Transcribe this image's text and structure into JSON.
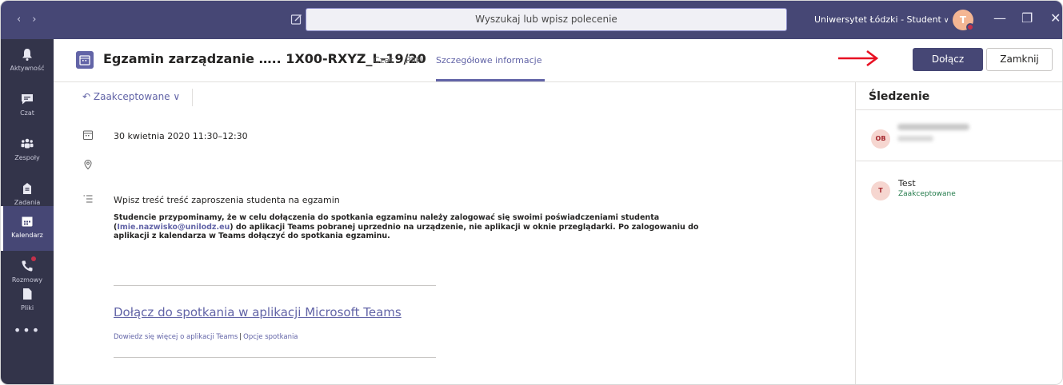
{
  "titlebar": {
    "search_placeholder": "Wyszukaj lub wpisz polecenie",
    "org": "Uniwersytet Łódzki - Student",
    "avatar_initial": "T",
    "minimize": "—",
    "maximize": "❐",
    "close": "✕",
    "nav": "‹›"
  },
  "rail": {
    "items": [
      {
        "label": "Aktywność",
        "icon": "bell-icon"
      },
      {
        "label": "Czat",
        "icon": "chat-icon"
      },
      {
        "label": "Zespoły",
        "icon": "teams-icon"
      },
      {
        "label": "Zadania",
        "icon": "assignments-icon"
      },
      {
        "label": "Kalendarz",
        "icon": "calendar-icon"
      },
      {
        "label": "Rozmowy",
        "icon": "phone-icon"
      },
      {
        "label": "Pliki",
        "icon": "file-icon"
      }
    ],
    "more": "•••",
    "active": "Kalendarz"
  },
  "header": {
    "title": "Egzamin zarządzanie ….. 1X00-RXYZ_L-19/20",
    "tabs": [
      {
        "label": "Czat"
      },
      {
        "label": "Pliki"
      },
      {
        "label": "Szczegółowe informacje"
      }
    ],
    "active_tab": "Szczegółowe informacje",
    "join_label": "Dołącz",
    "close_label": "Zamknij",
    "arrow_color": "#e81123"
  },
  "main": {
    "response": "Zaakceptowane",
    "date": "30 kwietnia 2020 11:30–12:30",
    "description": "Wpisz treść treść zaproszenia studenta na egzamin",
    "notice_before": "Studencie przypominamy, że w celu dołączenia do spotkania egzaminu należy zalogować się swoimi poświadczeniami studenta (",
    "notice_link": "Imie.nazwisko@unilodz.eu",
    "notice_after": ") do aplikacji Teams pobranej uprzednio na urządzenie, nie aplikacji w oknie przeglądarki. Po zalogowaniu do aplikacji z kalendarza w Teams dołączyć do spotkania egzaminu.",
    "join_link": "Dołącz do spotkania w aplikacji Microsoft Teams",
    "learn_more": "Dowiedz się więcej o aplikacji Teams",
    "separator": "|",
    "meeting_options": "Opcje spotkania"
  },
  "side": {
    "title": "Śledzenie",
    "organizer_initials": "OB",
    "attendee_initial": "T",
    "attendee_name": "Test",
    "attendee_status": "Zaakceptowane"
  },
  "colors": {
    "brand": "#6264a7",
    "titlebar": "#464775",
    "rail": "#33344a",
    "accepted": "#237b4b"
  }
}
